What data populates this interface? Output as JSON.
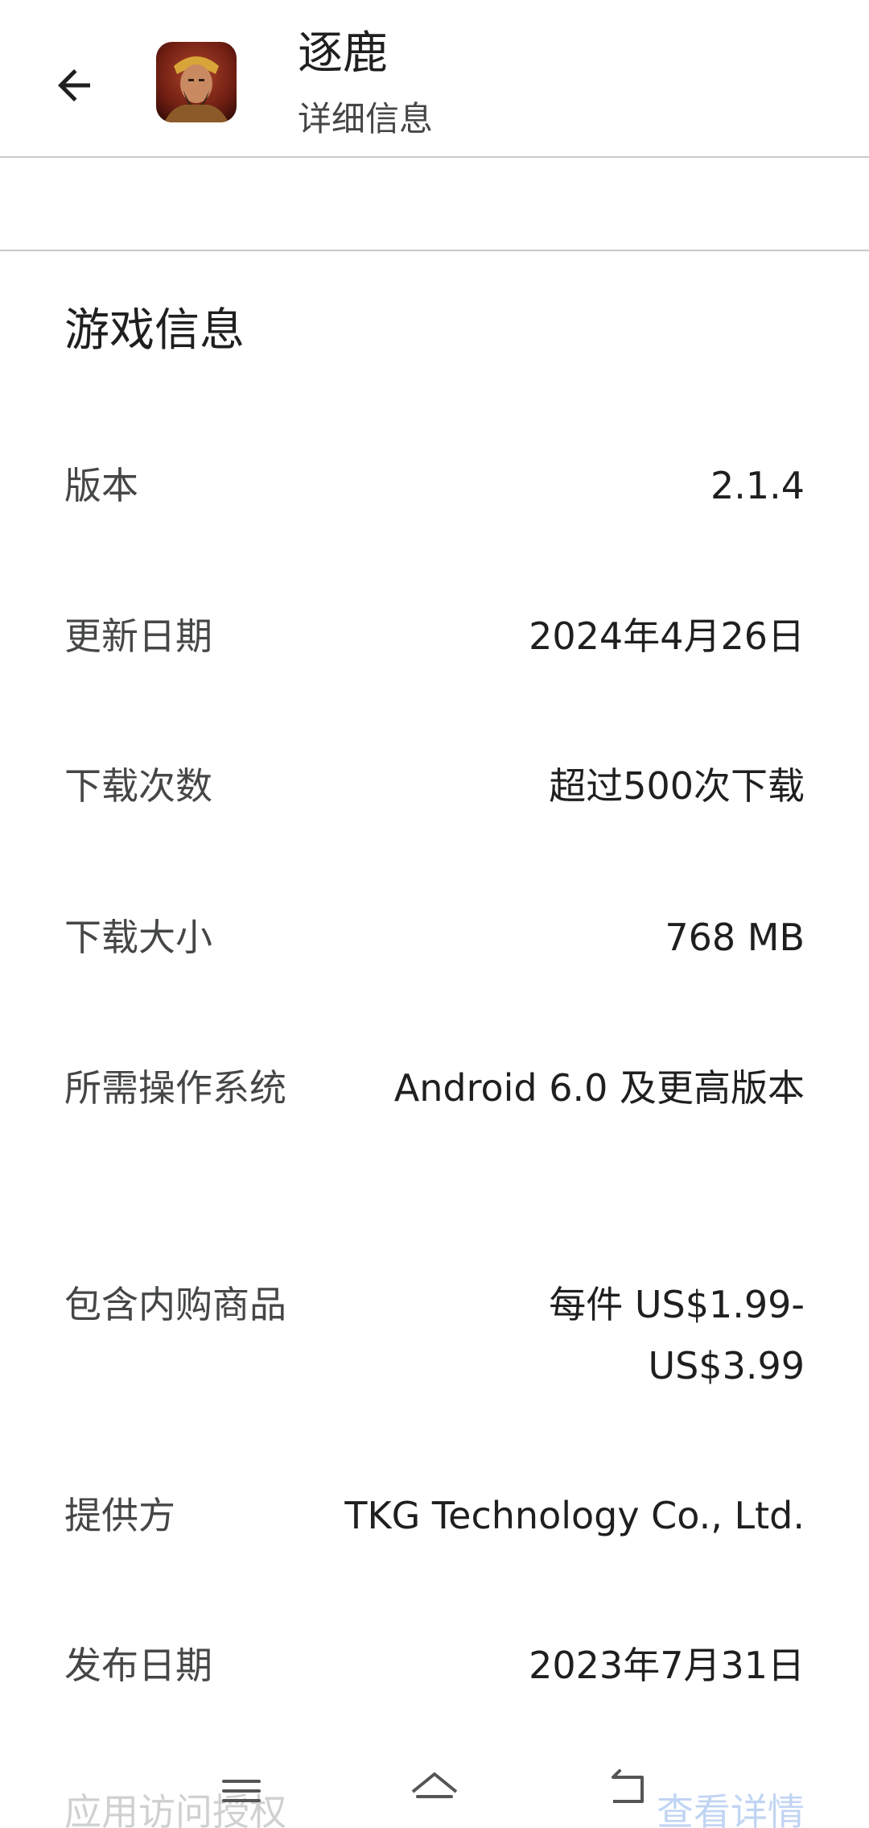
{
  "header": {
    "title": "逐鹿",
    "subtitle": "详细信息",
    "back_icon": "arrow-back-icon",
    "app_icon": "app-icon-warlord-portrait"
  },
  "section": {
    "title": "游戏信息"
  },
  "rows": [
    {
      "label": "版本",
      "value": "2.1.4"
    },
    {
      "label": "更新日期",
      "value": "2024年4月26日"
    },
    {
      "label": "下载次数",
      "value": "超过500次下载"
    },
    {
      "label": "下载大小",
      "value": "768 MB"
    },
    {
      "label": "所需操作系统",
      "value": "Android 6.0 及更高版本"
    },
    {
      "label": "包含内购商品",
      "value": "每件 US$1.99-US$3.99"
    },
    {
      "label": "提供方",
      "value": "TKG Technology Co., Ltd."
    },
    {
      "label": "发布日期",
      "value": "2023年7月31日"
    },
    {
      "label": "应用访问授权",
      "value": "查看详情"
    }
  ],
  "navbar": {
    "recents_icon": "menu-lines-icon",
    "home_icon": "home-icon",
    "back_icon": "back-return-icon"
  },
  "colors": {
    "link": "#0b57d0",
    "divider": "#c9c9c9",
    "label": "#444746"
  }
}
